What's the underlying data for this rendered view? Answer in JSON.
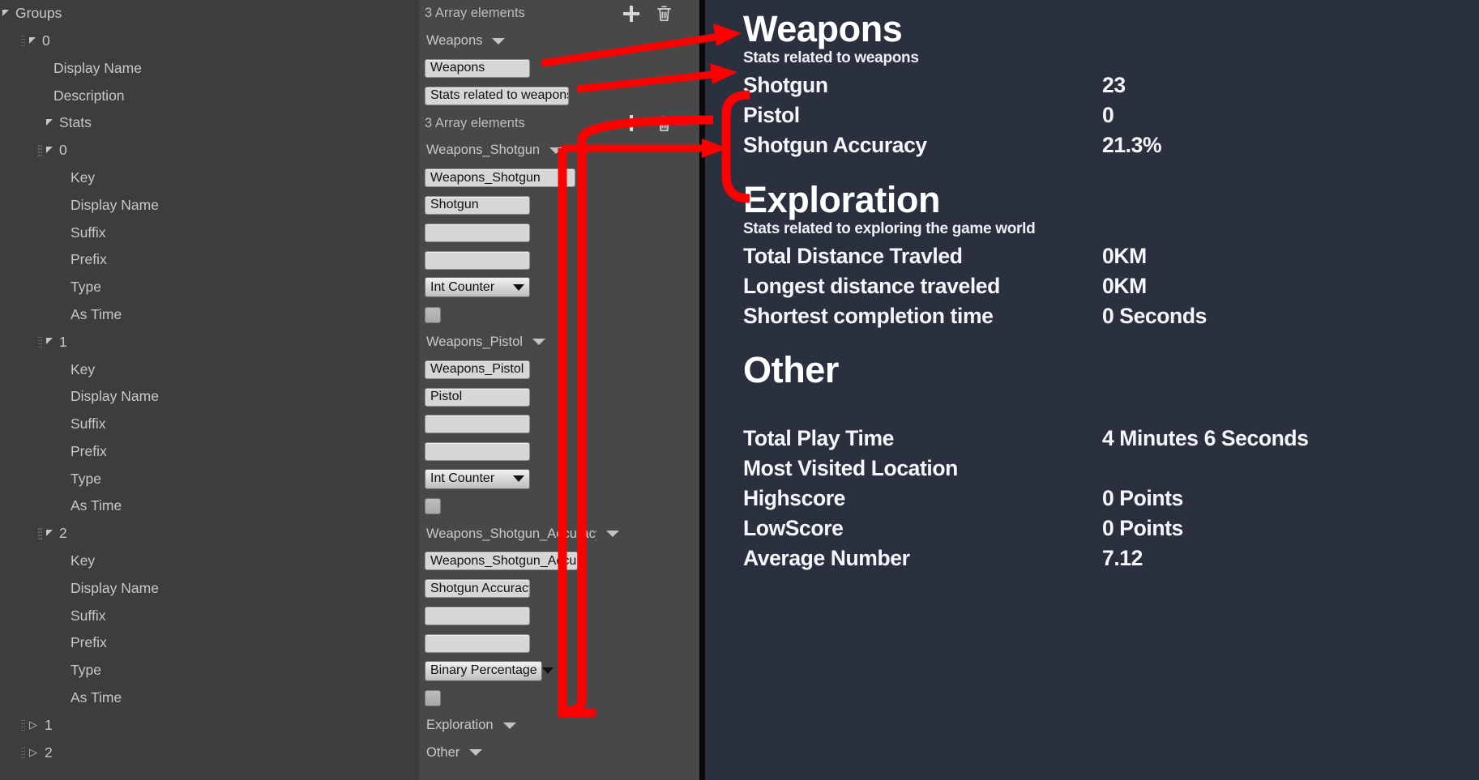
{
  "tree": {
    "root_label": "Groups",
    "rows": [
      {
        "indent": 0,
        "grip": false,
        "twisty": "down",
        "label": "Groups"
      },
      {
        "indent": 1,
        "grip": true,
        "twisty": "down",
        "label": "0"
      },
      {
        "indent": 3,
        "grip": false,
        "twisty": "none",
        "label": "Display Name"
      },
      {
        "indent": 3,
        "grip": false,
        "twisty": "none",
        "label": "Description"
      },
      {
        "indent": 2,
        "grip": false,
        "twisty": "down",
        "label": "Stats"
      },
      {
        "indent": 2,
        "grip": true,
        "twisty": "down",
        "label": "0"
      },
      {
        "indent": 4,
        "grip": false,
        "twisty": "none",
        "label": "Key"
      },
      {
        "indent": 4,
        "grip": false,
        "twisty": "none",
        "label": "Display Name"
      },
      {
        "indent": 4,
        "grip": false,
        "twisty": "none",
        "label": "Suffix"
      },
      {
        "indent": 4,
        "grip": false,
        "twisty": "none",
        "label": "Prefix"
      },
      {
        "indent": 4,
        "grip": false,
        "twisty": "none",
        "label": "Type"
      },
      {
        "indent": 4,
        "grip": false,
        "twisty": "none",
        "label": "As Time"
      },
      {
        "indent": 2,
        "grip": true,
        "twisty": "down",
        "label": "1"
      },
      {
        "indent": 4,
        "grip": false,
        "twisty": "none",
        "label": "Key"
      },
      {
        "indent": 4,
        "grip": false,
        "twisty": "none",
        "label": "Display Name"
      },
      {
        "indent": 4,
        "grip": false,
        "twisty": "none",
        "label": "Suffix"
      },
      {
        "indent": 4,
        "grip": false,
        "twisty": "none",
        "label": "Prefix"
      },
      {
        "indent": 4,
        "grip": false,
        "twisty": "none",
        "label": "Type"
      },
      {
        "indent": 4,
        "grip": false,
        "twisty": "none",
        "label": "As Time"
      },
      {
        "indent": 2,
        "grip": true,
        "twisty": "down",
        "label": "2"
      },
      {
        "indent": 4,
        "grip": false,
        "twisty": "none",
        "label": "Key"
      },
      {
        "indent": 4,
        "grip": false,
        "twisty": "none",
        "label": "Display Name"
      },
      {
        "indent": 4,
        "grip": false,
        "twisty": "none",
        "label": "Suffix"
      },
      {
        "indent": 4,
        "grip": false,
        "twisty": "none",
        "label": "Prefix"
      },
      {
        "indent": 4,
        "grip": false,
        "twisty": "none",
        "label": "Type"
      },
      {
        "indent": 4,
        "grip": false,
        "twisty": "none",
        "label": "As Time"
      },
      {
        "indent": 1,
        "grip": true,
        "twisty": "right",
        "label": "1"
      },
      {
        "indent": 1,
        "grip": true,
        "twisty": "right",
        "label": "2"
      }
    ]
  },
  "properties": {
    "rows": [
      {
        "kind": "array-header",
        "label": "3 Array elements",
        "add_icon": "plus-icon",
        "delete_icon": "trash-icon"
      },
      {
        "kind": "dropdown",
        "label": "Weapons"
      },
      {
        "kind": "text",
        "value": "Weapons",
        "width": "tf-w1"
      },
      {
        "kind": "text",
        "value": "Stats related to weapons",
        "width": "tf-w2"
      },
      {
        "kind": "array-header",
        "label": "3 Array elements",
        "add_icon": "plus-icon",
        "delete_icon": "trash-icon"
      },
      {
        "kind": "dropdown",
        "label": "Weapons_Shotgun"
      },
      {
        "kind": "text",
        "value": "Weapons_Shotgun",
        "width": "tf-w3"
      },
      {
        "kind": "text",
        "value": "Shotgun",
        "width": "tf-w1"
      },
      {
        "kind": "text",
        "value": "",
        "width": "tf-w1"
      },
      {
        "kind": "text",
        "value": "",
        "width": "tf-w1"
      },
      {
        "kind": "combo",
        "value": "Int Counter",
        "width": "combo"
      },
      {
        "kind": "checkbox",
        "checked": false
      },
      {
        "kind": "dropdown",
        "label": "Weapons_Pistol"
      },
      {
        "kind": "text",
        "value": "Weapons_Pistol",
        "width": "tf-w1"
      },
      {
        "kind": "text",
        "value": "Pistol",
        "width": "tf-w1"
      },
      {
        "kind": "text",
        "value": "",
        "width": "tf-w1"
      },
      {
        "kind": "text",
        "value": "",
        "width": "tf-w1"
      },
      {
        "kind": "combo",
        "value": "Int Counter",
        "width": "combo"
      },
      {
        "kind": "checkbox",
        "checked": false
      },
      {
        "kind": "dropdown",
        "label": "Weapons_Shotgun_Accuracy"
      },
      {
        "kind": "text",
        "value": "Weapons_Shotgun_Accuracy",
        "width": "tf-w4"
      },
      {
        "kind": "text",
        "value": "Shotgun Accuracy",
        "width": "tf-w1"
      },
      {
        "kind": "text",
        "value": "",
        "width": "tf-w1"
      },
      {
        "kind": "text",
        "value": "",
        "width": "tf-w1"
      },
      {
        "kind": "combo",
        "value": "Binary Percentage",
        "width": "combo-w2"
      },
      {
        "kind": "checkbox",
        "checked": false
      },
      {
        "kind": "dropdown",
        "label": "Exploration"
      },
      {
        "kind": "dropdown",
        "label": "Other"
      }
    ]
  },
  "game": {
    "sections": [
      {
        "title": "Weapons",
        "description": "Stats related to weapons",
        "stats": [
          {
            "name": "Shotgun",
            "value": "23"
          },
          {
            "name": "Pistol",
            "value": "0"
          },
          {
            "name": "Shotgun Accuracy",
            "value": "21.3%"
          }
        ]
      },
      {
        "title": "Exploration",
        "description": "Stats related to exploring the game world",
        "stats": [
          {
            "name": "Total Distance Travled",
            "value": "0KM"
          },
          {
            "name": "Longest distance traveled",
            "value": "0KM"
          },
          {
            "name": "Shortest completion time",
            "value": "0 Seconds"
          }
        ]
      },
      {
        "title": "Other",
        "description": "",
        "stats": [
          {
            "name": "Total Play Time",
            "value": "4 Minutes 6 Seconds"
          },
          {
            "name": "Most Visited Location",
            "value": ""
          },
          {
            "name": "Highscore",
            "value": "0 Points"
          },
          {
            "name": "LowScore",
            "value": "0 Points"
          },
          {
            "name": "Average Number",
            "value": "7.12"
          }
        ]
      }
    ]
  },
  "annotations": {
    "color": "#FF0000",
    "arrows": [
      {
        "name": "weapons-title-arrow"
      },
      {
        "name": "weapons-description-arrow"
      },
      {
        "name": "stats-group-arrow"
      }
    ]
  },
  "colors": {
    "tree_bg": "#3d3d3d",
    "property_bg": "#484848",
    "game_bg": "#2b303e",
    "divider": "#0a0a0a",
    "annotation_red": "#FF0000",
    "field_bg": "#d6d6d6",
    "text_light": "#c8c8c8",
    "text_white": "#f4f6fa"
  }
}
